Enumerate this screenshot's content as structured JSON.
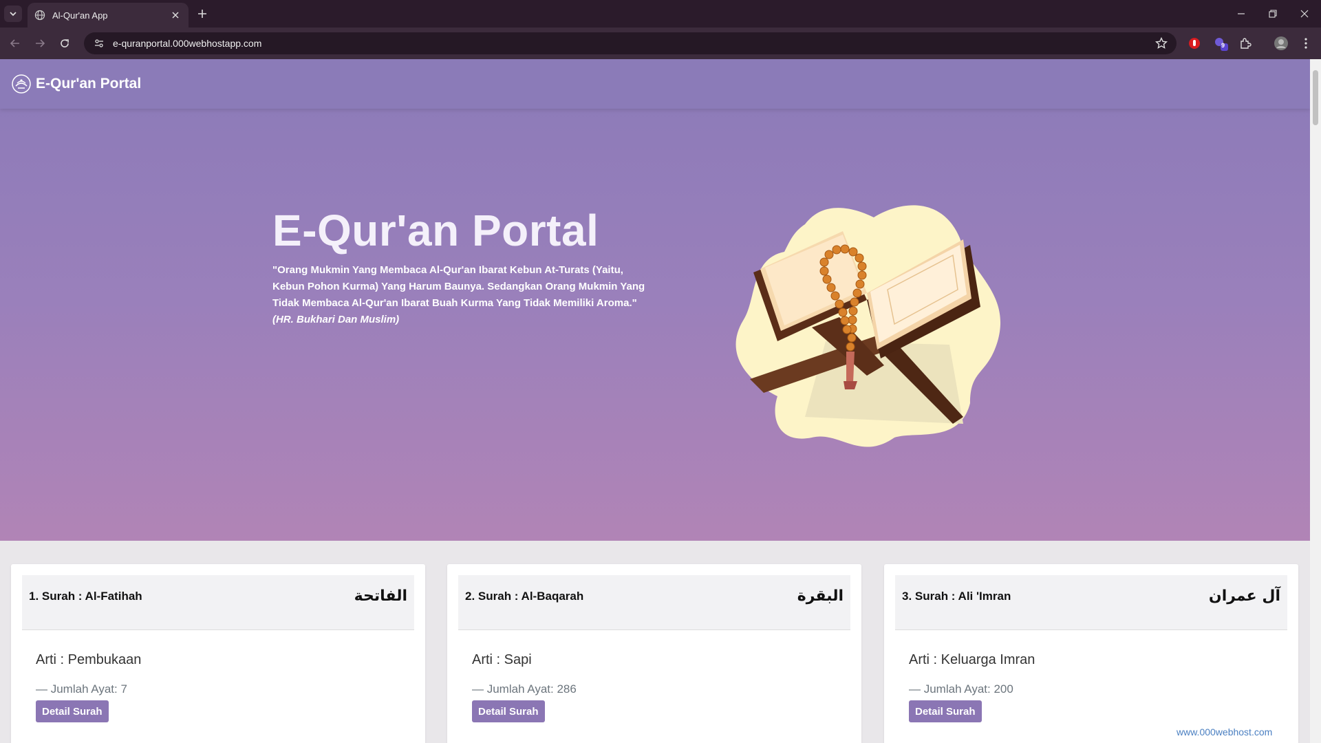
{
  "browser": {
    "tab_title": "Al-Qur'an App",
    "url": "e-quranportal.000webhostapp.com",
    "extension_badge": "9"
  },
  "navbar": {
    "brand": "E-Qur'an Portal"
  },
  "hero": {
    "title": "E-Qur'an Portal",
    "quote": "\"Orang Mukmin Yang Membaca Al-Qur'an Ibarat Kebun At-Turats (Yaitu, Kebun Pohon Kurma) Yang Harum Baunya. Sedangkan Orang Mukmin Yang Tidak Membaca Al-Qur'an Ibarat Buah Kurma Yang Tidak Memiliki Aroma.\"",
    "citation": "(HR. Bukhari Dan Muslim)"
  },
  "surahs": [
    {
      "name": "1. Surah : Al-Fatihah",
      "arabic": "الفاتحة",
      "arti": "Arti : Pembukaan",
      "jumlah": "— Jumlah Ayat: 7",
      "button": "Detail Surah"
    },
    {
      "name": "2. Surah : Al-Baqarah",
      "arabic": "البقرة",
      "arti": "Arti : Sapi",
      "jumlah": "— Jumlah Ayat: 286",
      "button": "Detail Surah"
    },
    {
      "name": "3. Surah : Ali 'Imran",
      "arabic": "آل عمران",
      "arti": "Arti : Keluarga Imran",
      "jumlah": "— Jumlah Ayat: 200",
      "button": "Detail Surah"
    }
  ],
  "host_badge": "www.000webhost.com"
}
